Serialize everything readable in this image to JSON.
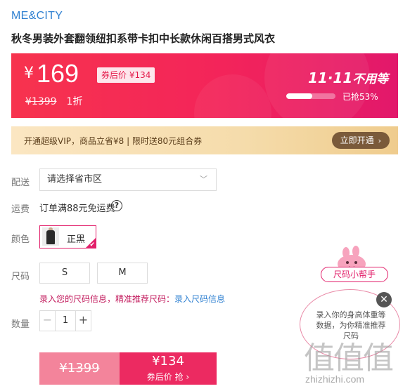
{
  "brand": "ME&CITY",
  "product_title": "秋冬男装外套翻领纽扣系带卡扣中长款休闲百搭男式风衣",
  "price": {
    "currency": "¥",
    "current": "169",
    "coupon_tag": "券后价 ¥134",
    "original": "¥1399",
    "discount": "1折"
  },
  "promo": {
    "title_b": "11·11",
    "title_rest": "不用等",
    "sold_text": "已抢53%",
    "sold_progress_percent": 53
  },
  "vip": {
    "text": "开通超级VIP，商品立省¥8 | 限时送80元组合券",
    "button": "立即开通",
    "chevron": "›"
  },
  "delivery": {
    "label": "配送",
    "placeholder": "请选择省市区",
    "caret": "﹀"
  },
  "shipping": {
    "label": "运费",
    "text": "订单满88元免运费",
    "help": "?"
  },
  "color": {
    "label": "颜色",
    "selected": "正黑",
    "check": "✔"
  },
  "size": {
    "label": "尺码",
    "options": [
      "S",
      "M"
    ],
    "hint": "录入您的尺码信息，精准推荐尺码：",
    "hint_link": "录入尺码信息"
  },
  "quantity": {
    "label": "数量",
    "value": "1",
    "minus": "−",
    "plus": "+"
  },
  "buy": {
    "original": "¥1399",
    "coupon_price": "¥134",
    "coupon_label": "券后价 抢 ›"
  },
  "helper": {
    "title": "尺码小帮手",
    "text": "录入你的身高体重等数据，为你精准推荐尺码",
    "close": "✕"
  },
  "watermark": {
    "cn": "值值值",
    "en": "zhizhizhi.com"
  },
  "colors": {
    "accent": "#e21f6a",
    "price_band": "#f3245a",
    "link": "#2f80d1"
  }
}
